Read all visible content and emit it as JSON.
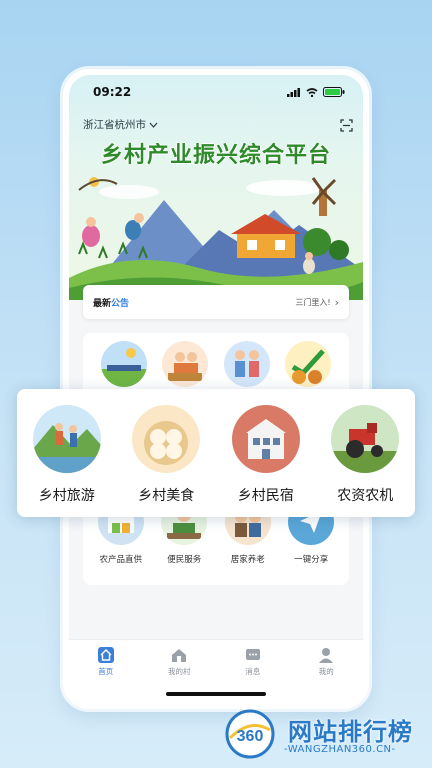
{
  "status_bar": {
    "time": "09:22"
  },
  "header": {
    "location": "浙江省杭州市",
    "title": "乡村产业振兴综合平台"
  },
  "notice": {
    "label_prefix": "最新",
    "label_suffix": "公告",
    "text": "三门里入!"
  },
  "services": [
    {
      "label": "农产品直供",
      "icon": "produce-stall-icon"
    },
    {
      "label": "便民服务",
      "icon": "service-desk-icon"
    },
    {
      "label": "居家养老",
      "icon": "elderly-care-icon"
    },
    {
      "label": "一键分享",
      "icon": "share-icon"
    }
  ],
  "popup": [
    {
      "label": "乡村旅游",
      "icon": "hiking-icon"
    },
    {
      "label": "乡村美食",
      "icon": "dumplings-icon"
    },
    {
      "label": "乡村民宿",
      "icon": "guesthouse-icon"
    },
    {
      "label": "农资农机",
      "icon": "tractor-icon"
    }
  ],
  "tabs": [
    {
      "label": "首页",
      "icon": "home-icon",
      "active": true
    },
    {
      "label": "我的村",
      "icon": "village-icon"
    },
    {
      "label": "消息",
      "icon": "message-icon"
    },
    {
      "label": "我的",
      "icon": "profile-icon"
    }
  ],
  "watermark": {
    "badge": "360",
    "title": "网站排行榜",
    "subtitle": "-WANGZHAN360.CN-"
  },
  "colors": {
    "accent": "#3b7fd6",
    "title_green": "#2e8a2a",
    "background": "#b9dcf4"
  }
}
